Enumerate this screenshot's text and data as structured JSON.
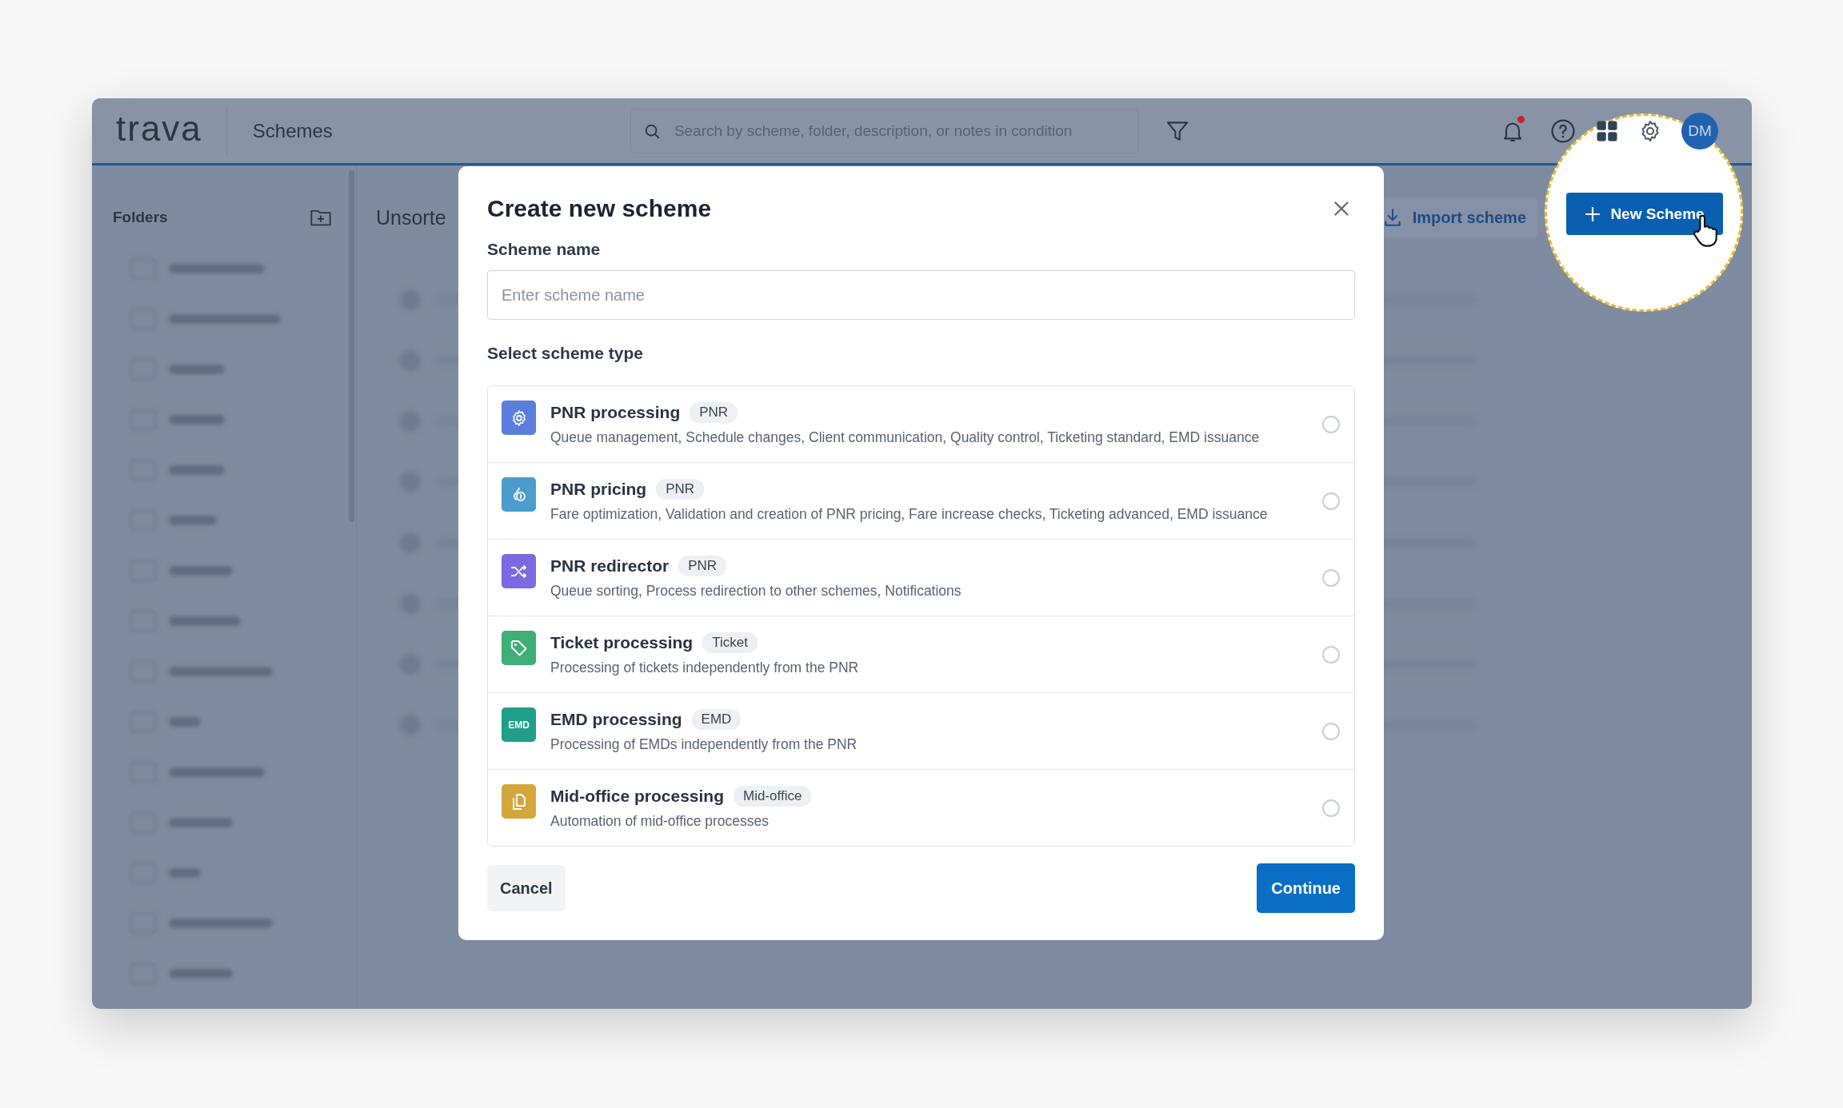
{
  "header": {
    "logo": "trava",
    "title": "Schemes",
    "search": {
      "placeholder": "Search by scheme, folder, description, or notes in condition"
    },
    "notifications_unread": true,
    "avatar": "DM"
  },
  "sidebar": {
    "title": "Folders"
  },
  "main": {
    "title": "Unsorte",
    "import_button": "Import scheme",
    "new_button": "New Scheme"
  },
  "dialog": {
    "title": "Create new scheme",
    "name_label": "Scheme name",
    "name_field": {
      "placeholder": "Enter scheme name"
    },
    "type_label": "Select scheme type",
    "options": [
      {
        "kind": "gear",
        "color": "#5a7fdc",
        "name": "PNR processing",
        "tag": "PNR",
        "description": "Queue management, Schedule changes, Client communication, Quality control, Ticketing standard, EMD issuance",
        "selected": false
      },
      {
        "kind": "coin",
        "color": "#4b9ccf",
        "name": "PNR pricing",
        "tag": "PNR",
        "description": "Fare optimization, Validation and creation of PNR pricing, Fare increase checks, Ticketing advanced, EMD issuance",
        "selected": false
      },
      {
        "kind": "shuffle",
        "color": "#7b6ae3",
        "name": "PNR redirector",
        "tag": "PNR",
        "description": "Queue sorting, Process redirection to other schemes, Notifications",
        "selected": false
      },
      {
        "kind": "tag",
        "color": "#3fae78",
        "name": "Ticket processing",
        "tag": "Ticket",
        "description": "Processing of tickets independently from the PNR",
        "selected": false
      },
      {
        "kind": "text",
        "icon_text": "EMD",
        "color": "#1f9f8a",
        "name": "EMD processing",
        "tag": "EMD",
        "description": "Processing of EMDs independently from the PNR",
        "selected": false
      },
      {
        "kind": "documents",
        "color": "#d4a73c",
        "name": "Mid-office processing",
        "tag": "Mid-office",
        "description": "Automation of mid-office processes",
        "selected": false
      }
    ],
    "cancel": "Cancel",
    "continue": "Continue"
  }
}
